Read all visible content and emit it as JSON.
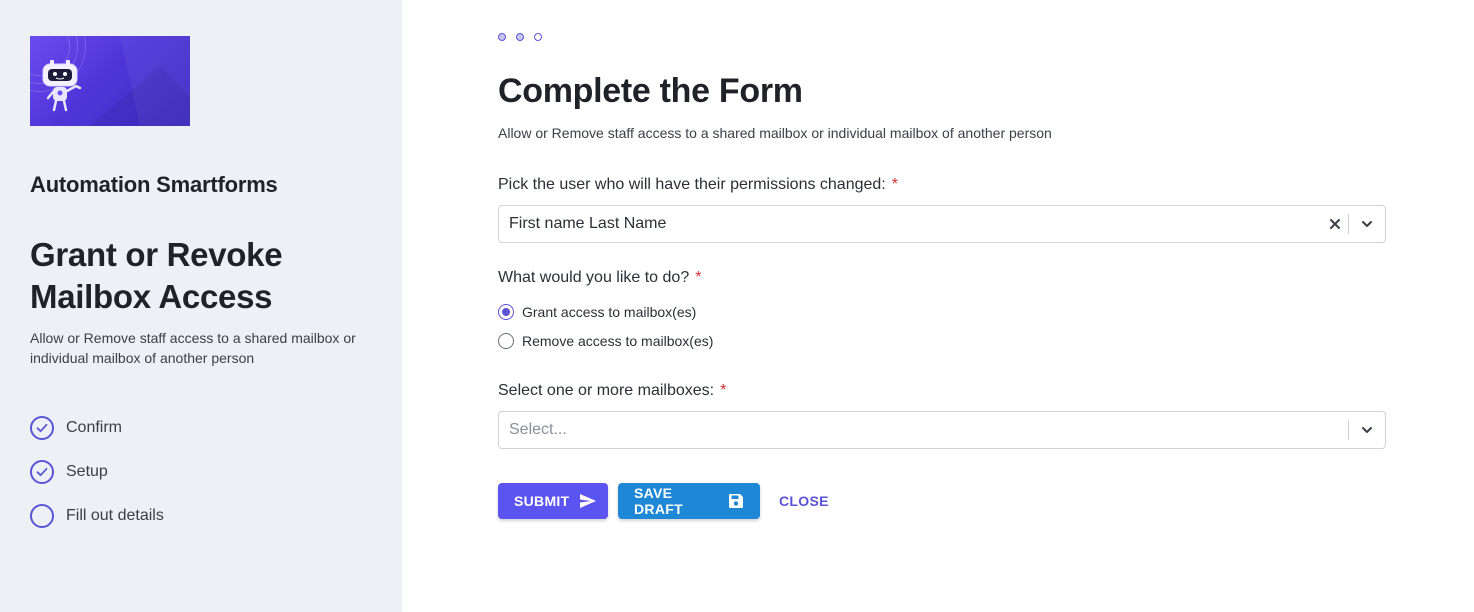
{
  "sidebar": {
    "app_title": "Automation Smartforms",
    "form_title": "Grant or Revoke Mailbox Access",
    "form_description": "Allow or Remove staff access to a shared mailbox or individual mailbox of another person",
    "steps": [
      {
        "label": "Confirm",
        "status": "completed"
      },
      {
        "label": "Setup",
        "status": "completed"
      },
      {
        "label": "Fill out details",
        "status": "current"
      }
    ]
  },
  "main": {
    "progress_dots": 3,
    "title": "Complete the Form",
    "description": "Allow or Remove staff access to a shared mailbox or individual mailbox of another person",
    "user_field": {
      "label": "Pick the user who will have their permissions changed:",
      "required_mark": "*",
      "value": "First name Last Name"
    },
    "action_field": {
      "label": "What would you like to do?",
      "required_mark": "*",
      "options": [
        {
          "label": "Grant access to mailbox(es)",
          "checked": true
        },
        {
          "label": "Remove access to mailbox(es)",
          "checked": false
        }
      ]
    },
    "mailbox_field": {
      "label": "Select one or more mailboxes:",
      "required_mark": "*",
      "placeholder": "Select..."
    },
    "buttons": {
      "submit": "SUBMIT",
      "save_draft": "SAVE DRAFT",
      "close": "CLOSE"
    }
  },
  "colors": {
    "accent": "#5b54f0",
    "draft": "#1e88d6",
    "required": "#d32f2f",
    "sidebar_bg": "#edf1f5"
  }
}
